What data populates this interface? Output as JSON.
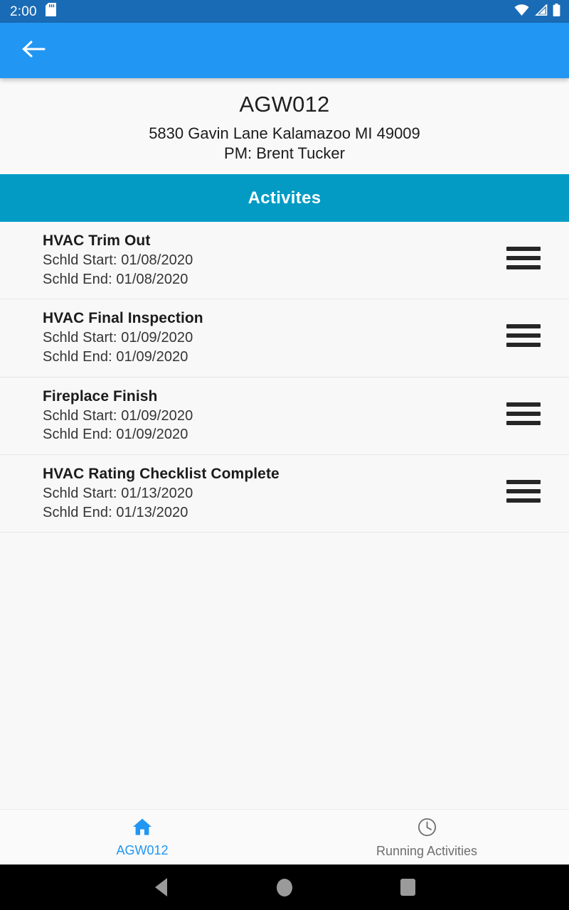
{
  "status_bar": {
    "time": "2:00",
    "icons": [
      "sd-card-icon",
      "wifi-icon",
      "cellular-signal-icon",
      "battery-icon"
    ],
    "background_color": "#1A6BB5"
  },
  "app_bar": {
    "back_label": "",
    "back_icon": "arrow-left-icon",
    "background_color": "#2196F3"
  },
  "project": {
    "code": "AGW012",
    "address": "5830 Gavin Lane Kalamazoo MI 49009",
    "pm": "PM: Brent Tucker"
  },
  "section": {
    "banner_label": "Activites",
    "banner_color": "#039BC4"
  },
  "activities": {
    "start_prefix": "Schld Start:",
    "end_prefix": "Schld End:",
    "items": [
      {
        "title": "HVAC Trim Out",
        "start_line": "Schld Start: 01/08/2020",
        "end_line": "Schld End: 01/08/2020",
        "start_date": "01/08/2020",
        "end_date": "01/08/2020",
        "handle_icon": "drag-handle-icon"
      },
      {
        "title": "HVAC Final Inspection",
        "start_line": "Schld Start: 01/09/2020",
        "end_line": "Schld End: 01/09/2020",
        "start_date": "01/09/2020",
        "end_date": "01/09/2020",
        "handle_icon": "drag-handle-icon"
      },
      {
        "title": "Fireplace Finish",
        "start_line": "Schld Start: 01/09/2020",
        "end_line": "Schld End: 01/09/2020",
        "start_date": "01/09/2020",
        "end_date": "01/09/2020",
        "handle_icon": "drag-handle-icon"
      },
      {
        "title": "HVAC Rating Checklist Complete",
        "start_line": "Schld Start: 01/13/2020",
        "end_line": "Schld End: 01/13/2020",
        "start_date": "01/13/2020",
        "end_date": "01/13/2020",
        "handle_icon": "drag-handle-icon"
      }
    ]
  },
  "bottom_nav": {
    "active_color": "#2196F3",
    "inactive_color": "#6E6E6E",
    "items": [
      {
        "label": "AGW012",
        "icon": "home-icon",
        "active": true
      },
      {
        "label": "Running Activities",
        "icon": "clock-icon",
        "active": false
      }
    ]
  },
  "system_nav": {
    "back": "back-triangle-icon",
    "home": "home-circle-icon",
    "recents": "recents-square-icon"
  }
}
